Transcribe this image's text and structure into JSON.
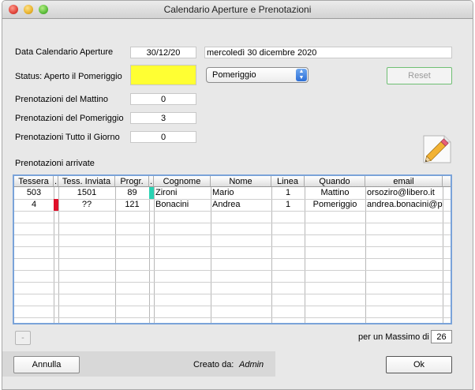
{
  "window": {
    "title": "Calendario Aperture e Prenotazioni"
  },
  "form": {
    "date_label": "Data Calendario Aperture",
    "date_value": "30/12/20",
    "date_long": "mercoledì 30 dicembre 2020",
    "status_label": "Status: Aperto il Pomeriggio",
    "status_color": "#ffff33",
    "period_selected": "Pomeriggio",
    "reset_label": "Reset",
    "morning_label": "Prenotazioni del Mattino",
    "morning_value": "0",
    "afternoon_label": "Prenotazioni del Pomeriggio",
    "afternoon_value": "3",
    "allday_label": "Prenotazioni Tutto il Giorno",
    "allday_value": "0",
    "arrived_label": "Prenotazioni arrivate"
  },
  "table": {
    "headers": [
      "Tessera",
      ".",
      "Tess. Inviata",
      "Progr.",
      ".",
      "Cognome",
      "Nome",
      "Linea",
      "Quando",
      "email"
    ],
    "rows": [
      {
        "tessera": "503",
        "flag_color": "",
        "inviata": "1501",
        "progr": "89",
        "marker_color": "#2ad3b3",
        "cognome": "Zironi",
        "nome": "Mario",
        "linea": "1",
        "quando": "Mattino",
        "email": "orsoziro@libero.it"
      },
      {
        "tessera": "4",
        "flag_color": "#e0102a",
        "inviata": "??",
        "progr": "121",
        "marker_color": "",
        "cognome": "Bonacini",
        "nome": "Andrea",
        "linea": "1",
        "quando": "Pomeriggio",
        "email": "andrea.bonacini@pc"
      }
    ]
  },
  "footer": {
    "max_label": "per un Massimo di",
    "max_value": "26",
    "cancel_label": "Annulla",
    "created_label": "Creato da:",
    "created_value": "Admin",
    "ok_label": "Ok",
    "small_button_label": "-"
  }
}
